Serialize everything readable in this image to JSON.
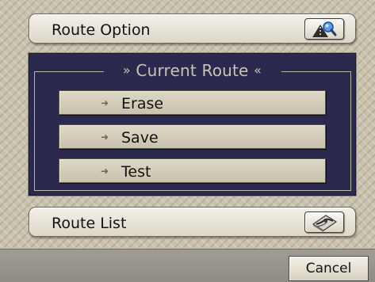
{
  "route_option": {
    "label": "Route Option",
    "icon": "route-search-icon"
  },
  "current_route": {
    "title": "Current Route",
    "title_left_deco": "»",
    "title_right_deco": "«",
    "buttons": [
      {
        "label": "Erase",
        "arrow": "➜"
      },
      {
        "label": "Save",
        "arrow": "➜"
      },
      {
        "label": "Test",
        "arrow": "➜"
      }
    ]
  },
  "route_list": {
    "label": "Route List",
    "icon": "route-map-icon"
  },
  "footer": {
    "cancel_label": "Cancel"
  },
  "colors": {
    "panel_background": "#2b2a4e",
    "panel_title_text": "#c9c3b2",
    "button_face": "#d3ccb9",
    "bottom_bar": "#989589",
    "icon_accent": "#2f6fd8"
  }
}
